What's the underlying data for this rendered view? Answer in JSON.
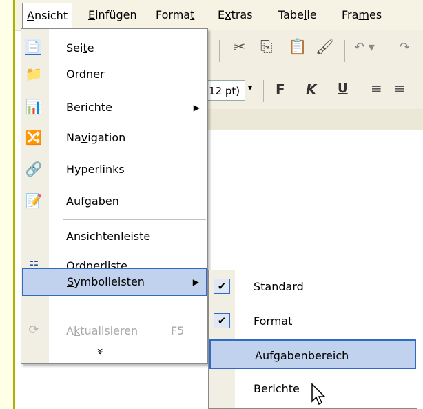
{
  "menubar": {
    "items": [
      {
        "label": "Ansicht",
        "x_hint": "open"
      },
      {
        "label": "Einfügen"
      },
      {
        "label": "Format"
      },
      {
        "label": "Extras"
      },
      {
        "label": "Tabelle"
      },
      {
        "label": "Frames"
      }
    ]
  },
  "toolbar": {
    "font_size": "12 pt)",
    "bold_label": "F",
    "italic_label": "K",
    "underline_label": "U"
  },
  "menu": {
    "items": [
      {
        "label": "Seite",
        "icon": "page-icon"
      },
      {
        "label": "Ordner",
        "icon": "folder-icon"
      },
      {
        "label": "Berichte",
        "icon": "reports-icon",
        "submenu": true
      },
      {
        "label": "Navigation",
        "icon": "navigation-icon"
      },
      {
        "label": "Hyperlinks",
        "icon": "hyperlinks-icon"
      },
      {
        "label": "Aufgaben",
        "icon": "tasks-icon"
      },
      {
        "label": "Ansichtenleiste"
      },
      {
        "label": "Ordnerliste",
        "icon": "folder-list-icon"
      },
      {
        "label": "Symbolleisten",
        "submenu": true,
        "highlighted": true
      },
      {
        "label": "Aktualisieren",
        "shortcut": "F5",
        "disabled": true,
        "icon": "refresh-icon"
      }
    ],
    "more_symbol": "»"
  },
  "submenu": {
    "items": [
      {
        "label": "Standard",
        "checked": true
      },
      {
        "label": "Format",
        "checked": true
      },
      {
        "label": "Aufgabenbereich",
        "checked": false,
        "highlighted": true
      },
      {
        "label": "Berichte",
        "checked": false
      }
    ]
  },
  "colors": {
    "highlight_bg": "#c1d2ee",
    "highlight_border": "#316ac5",
    "menubar_bg": "#f6f2e4",
    "left_strip_border": "#a8b400"
  }
}
